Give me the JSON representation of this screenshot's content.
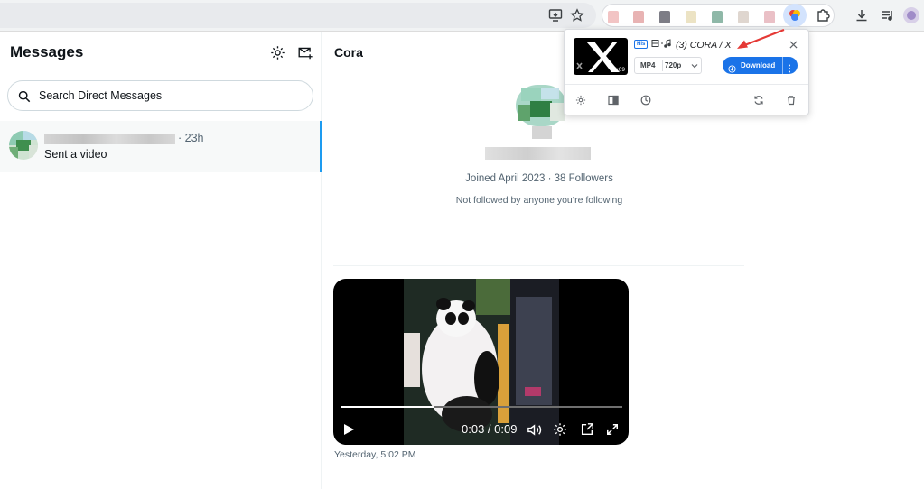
{
  "left": {
    "title": "Messages",
    "search_placeholder": "Search Direct Messages",
    "conversation": {
      "time": "· 23h",
      "preview": "Sent a video"
    }
  },
  "main": {
    "title": "Cora",
    "profile_stats": "Joined April 2023 · 38 Followers",
    "not_followed": "Not followed by anyone you’re following",
    "video": {
      "time_display": "0:03 / 0:09",
      "progress_fraction": 0.33
    },
    "timestamp": "Yesterday, 5:02 PM"
  },
  "popup": {
    "badge": "Hls",
    "title": "(3) CORA / X",
    "thumb_duration": "00:09",
    "format": "MP4",
    "quality": "720p",
    "download_label": "Download"
  },
  "colors": {
    "accent_blue": "#1d9bf0",
    "download_blue": "#1a73e8",
    "arrow_red": "#e53935"
  }
}
